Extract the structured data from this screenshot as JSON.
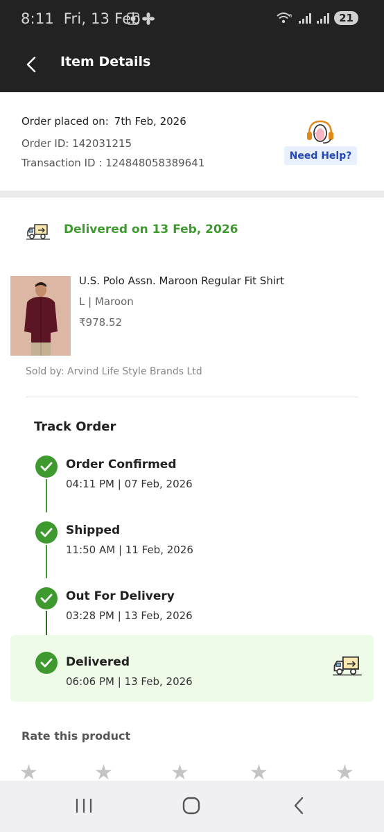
{
  "status_bar": {
    "time": "8:11",
    "date": "Fri, 13 Feb",
    "battery": "21"
  },
  "app_bar": {
    "title": "Item Details",
    "back_icon": "back-arrow-icon"
  },
  "order": {
    "placed_label": "Order placed on:",
    "placed_date": "7th Feb, 2026",
    "order_id": "Order ID: 142031215",
    "transaction_id": "Transaction ID : 124848058389641",
    "help_label": "Need Help?"
  },
  "delivery": {
    "status": "Delivered on 13 Feb, 2026",
    "color": "#3e9a2e"
  },
  "product": {
    "name": "U.S. Polo Assn. Maroon Regular Fit Shirt",
    "variant": "L | Maroon",
    "price": "₹978.52",
    "seller": "Sold by: Arvind Life Style Brands Ltd"
  },
  "track": {
    "title": "Track Order",
    "steps": [
      {
        "label": "Order Confirmed",
        "time": "04:11 PM | 07 Feb, 2026"
      },
      {
        "label": "Shipped",
        "time": "11:50 AM | 11 Feb, 2026"
      },
      {
        "label": "Out For Delivery",
        "time": "03:28 PM | 13 Feb, 2026"
      },
      {
        "label": "Delivered",
        "time": "06:06 PM | 13 Feb, 2026"
      }
    ]
  },
  "rating": {
    "title": "Rate this product",
    "stars": 5
  },
  "nav": {
    "recents": "recents-icon",
    "home": "home-icon",
    "back": "back-icon"
  }
}
